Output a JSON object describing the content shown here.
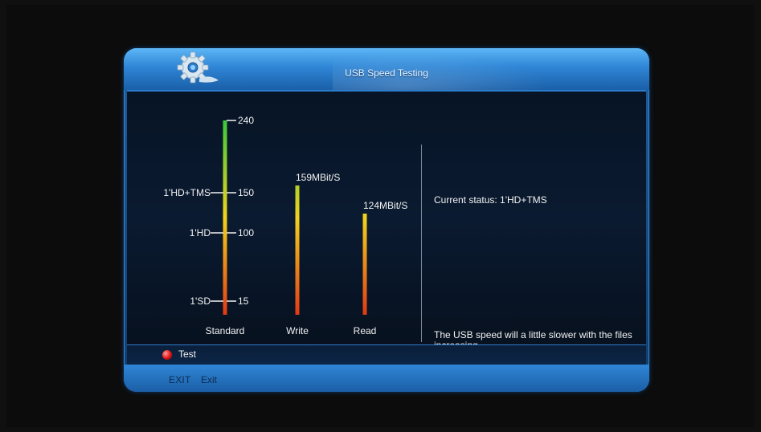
{
  "window": {
    "title": "USB Speed Testing"
  },
  "chart_data": {
    "type": "bar",
    "categories": [
      "Standard",
      "Write",
      "Read"
    ],
    "standard_ticks": [
      {
        "value": 240,
        "label": ""
      },
      {
        "value": 150,
        "label": "1'HD+TMS"
      },
      {
        "value": 100,
        "label": "1'HD"
      },
      {
        "value": 15,
        "label": "1'SD"
      }
    ],
    "bars": [
      {
        "name": "Standard",
        "value": 240,
        "value_label": ""
      },
      {
        "name": "Write",
        "value": 159,
        "value_label": "159MBit/S"
      },
      {
        "name": "Read",
        "value": 124,
        "value_label": "124MBit/S"
      }
    ],
    "ylim": [
      0,
      240
    ],
    "colors": {
      "green": "#3cc83c",
      "yellow": "#f2d21c",
      "red": "#e23a14"
    }
  },
  "status": {
    "current": "Current status: 1'HD+TMS"
  },
  "note": {
    "text": "The USB speed will a little slower with the files increasing"
  },
  "actions": {
    "test_label": "Test"
  },
  "footer": {
    "exit_key": "EXIT",
    "exit_label": "Exit"
  }
}
